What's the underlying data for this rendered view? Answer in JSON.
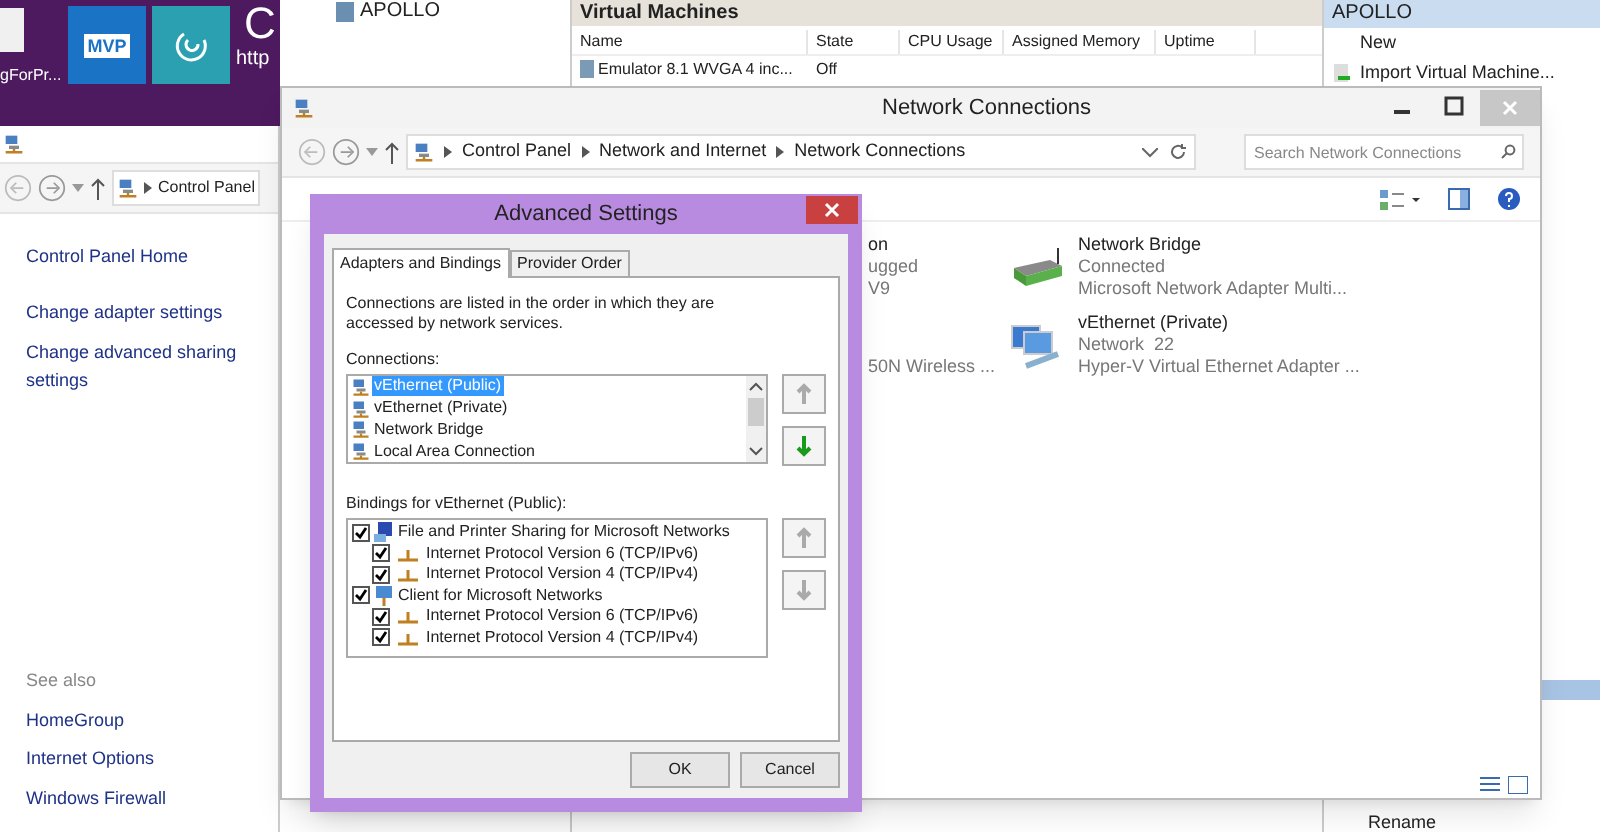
{
  "start_screen": {
    "tile_label": "gForPr...",
    "mvp_tile": "MVP",
    "heading": "C",
    "url": "http"
  },
  "hyperv": {
    "tree_item": "APOLLO",
    "panel_title": "Virtual Machines",
    "columns": [
      "Name",
      "State",
      "CPU Usage",
      "Assigned Memory",
      "Uptime"
    ],
    "rows": [
      {
        "name": "Emulator 8.1 WVGA 4 inc...",
        "state": "Off"
      }
    ],
    "actions_title": "APOLLO",
    "actions": [
      "New",
      "Import Virtual Machine..."
    ],
    "bottom_actions": [
      "Rename"
    ]
  },
  "control_panel": {
    "breadcrumb": [
      "Control Panel"
    ],
    "links": [
      "Control Panel Home",
      "Change adapter settings",
      "Change advanced sharing settings"
    ],
    "see_also_title": "See also",
    "see_also": [
      "HomeGroup",
      "Internet Options",
      "Windows Firewall"
    ]
  },
  "network_connections": {
    "title": "Network Connections",
    "breadcrumb": [
      "Control Panel",
      "Network and Internet",
      "Network Connections"
    ],
    "search": {
      "placeholder": "Search Network Connections"
    },
    "partial_items": [
      {
        "name": "on",
        "status": "ugged",
        "device": "V9"
      },
      {
        "device": "50N Wireless ..."
      }
    ],
    "items": [
      {
        "kind": "bridge",
        "name": "Network Bridge",
        "status": "Connected",
        "device": "Microsoft Network Adapter Multi..."
      },
      {
        "kind": "computer",
        "name": "vEthernet (Private)",
        "status": "Network  22",
        "device": "Hyper-V Virtual Ethernet Adapter ..."
      }
    ]
  },
  "advanced_settings": {
    "title": "Advanced Settings",
    "tabs": [
      {
        "label": "Adapters and Bindings",
        "selected": true
      },
      {
        "label": "Provider Order",
        "selected": false
      }
    ],
    "description": "Connections are listed in the order in which they are accessed by network services.",
    "connections_label": "Connections:",
    "connections": [
      {
        "name": "vEthernet (Public)",
        "selected": true
      },
      {
        "name": "vEthernet (Private)",
        "selected": false
      },
      {
        "name": "Network Bridge",
        "selected": false
      },
      {
        "name": "Local Area Connection",
        "selected": false
      }
    ],
    "connection_moves": [
      {
        "kind": "up",
        "disabled": true
      },
      {
        "kind": "down",
        "disabled": false
      }
    ],
    "bindings_label": "Bindings for vEthernet (Public):",
    "bindings": [
      {
        "kind": "service",
        "name": "File and Printer Sharing for Microsoft Networks",
        "checked": true,
        "children": [
          {
            "name": "Internet Protocol Version 6 (TCP/IPv6)",
            "checked": true
          },
          {
            "name": "Internet Protocol Version 4 (TCP/IPv4)",
            "checked": true
          }
        ]
      },
      {
        "kind": "client",
        "name": "Client for Microsoft Networks",
        "checked": true,
        "children": [
          {
            "name": "Internet Protocol Version 6 (TCP/IPv6)",
            "checked": true
          },
          {
            "name": "Internet Protocol Version 4 (TCP/IPv4)",
            "checked": true
          }
        ]
      }
    ],
    "binding_moves": [
      {
        "kind": "up",
        "disabled": true
      },
      {
        "kind": "down",
        "disabled": true
      }
    ],
    "buttons": [
      "OK",
      "Cancel"
    ]
  }
}
